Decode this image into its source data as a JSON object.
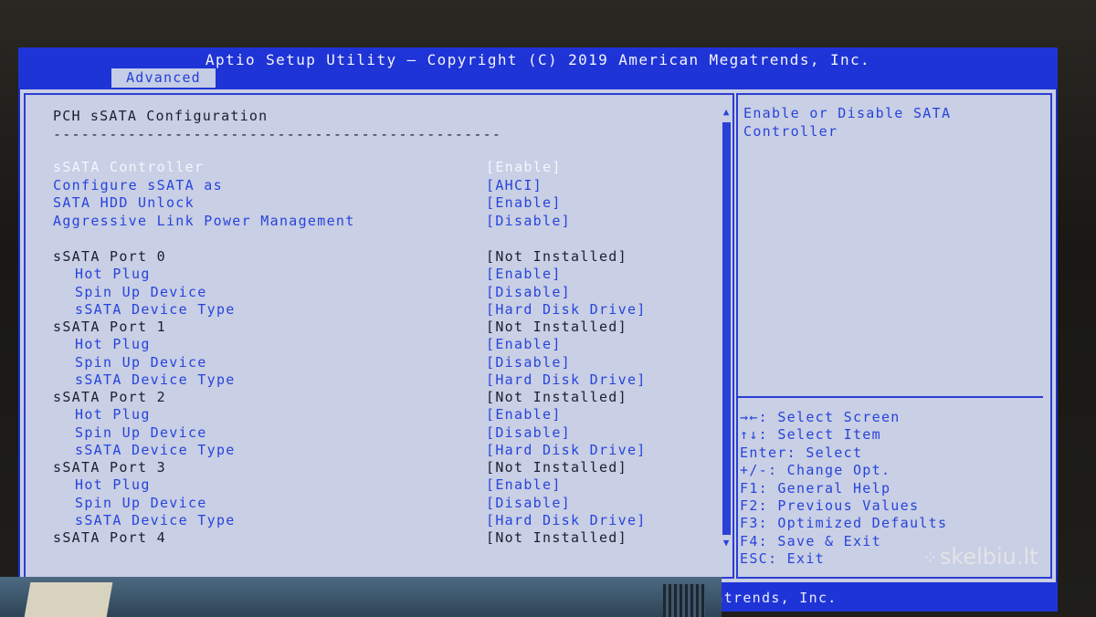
{
  "header": {
    "title": "Aptio Setup Utility – Copyright (C) 2019 American Megatrends, Inc.",
    "active_tab": "Advanced"
  },
  "page": {
    "section_title": "PCH sSATA Configuration",
    "divider": "------------------------------------------------"
  },
  "settings": [
    {
      "label": "sSATA Controller",
      "value": "[Enable]",
      "indent": 0,
      "kind": "sel"
    },
    {
      "label": "Configure sSATA as",
      "value": "[AHCI]",
      "indent": 0,
      "kind": "opt"
    },
    {
      "label": "SATA HDD Unlock",
      "value": "[Enable]",
      "indent": 0,
      "kind": "opt"
    },
    {
      "label": "Aggressive Link Power Management",
      "value": "[Disable]",
      "indent": 0,
      "kind": "opt"
    },
    {
      "label": "sSATA Port 0",
      "value": "[Not Installed]",
      "indent": 0,
      "kind": "hdr"
    },
    {
      "label": "Hot Plug",
      "value": "[Enable]",
      "indent": 1,
      "kind": "opt"
    },
    {
      "label": "Spin Up Device",
      "value": "[Disable]",
      "indent": 1,
      "kind": "opt"
    },
    {
      "label": "sSATA Device Type",
      "value": "[Hard Disk Drive]",
      "indent": 1,
      "kind": "opt"
    },
    {
      "label": "sSATA Port 1",
      "value": "[Not Installed]",
      "indent": 0,
      "kind": "hdr"
    },
    {
      "label": "Hot Plug",
      "value": "[Enable]",
      "indent": 1,
      "kind": "opt"
    },
    {
      "label": "Spin Up Device",
      "value": "[Disable]",
      "indent": 1,
      "kind": "opt"
    },
    {
      "label": "sSATA Device Type",
      "value": "[Hard Disk Drive]",
      "indent": 1,
      "kind": "opt"
    },
    {
      "label": "sSATA Port 2",
      "value": "[Not Installed]",
      "indent": 0,
      "kind": "hdr"
    },
    {
      "label": "Hot Plug",
      "value": "[Enable]",
      "indent": 1,
      "kind": "opt"
    },
    {
      "label": "Spin Up Device",
      "value": "[Disable]",
      "indent": 1,
      "kind": "opt"
    },
    {
      "label": "sSATA Device Type",
      "value": "[Hard Disk Drive]",
      "indent": 1,
      "kind": "opt"
    },
    {
      "label": "sSATA Port 3",
      "value": "[Not Installed]",
      "indent": 0,
      "kind": "hdr"
    },
    {
      "label": "Hot Plug",
      "value": "[Enable]",
      "indent": 1,
      "kind": "opt"
    },
    {
      "label": "Spin Up Device",
      "value": "[Disable]",
      "indent": 1,
      "kind": "opt"
    },
    {
      "label": "sSATA Device Type",
      "value": "[Hard Disk Drive]",
      "indent": 1,
      "kind": "opt"
    },
    {
      "label": "sSATA Port 4",
      "value": "[Not Installed]",
      "indent": 0,
      "kind": "hdr"
    }
  ],
  "help": {
    "description": "Enable or Disable SATA Controller",
    "keys": [
      "→←: Select Screen",
      "↑↓: Select Item",
      "Enter: Select",
      "+/-: Change Opt.",
      "F1: General Help",
      "F2: Previous Values",
      "F3: Optimized Defaults",
      "F4: Save & Exit",
      "ESC: Exit"
    ]
  },
  "scrollbar": {
    "up_glyph": "▲",
    "down_glyph": "▼"
  },
  "footer": {
    "text": "gatrends, Inc."
  },
  "watermark": {
    "text": "skelbiu.lt",
    "dots": "⁘"
  },
  "colors": {
    "title_bar": "#1f34d6",
    "panel_bg": "#c9cfe4",
    "selected_text": "#f4f6ff",
    "option_text": "#2744dc",
    "static_text": "#1b1f30"
  }
}
